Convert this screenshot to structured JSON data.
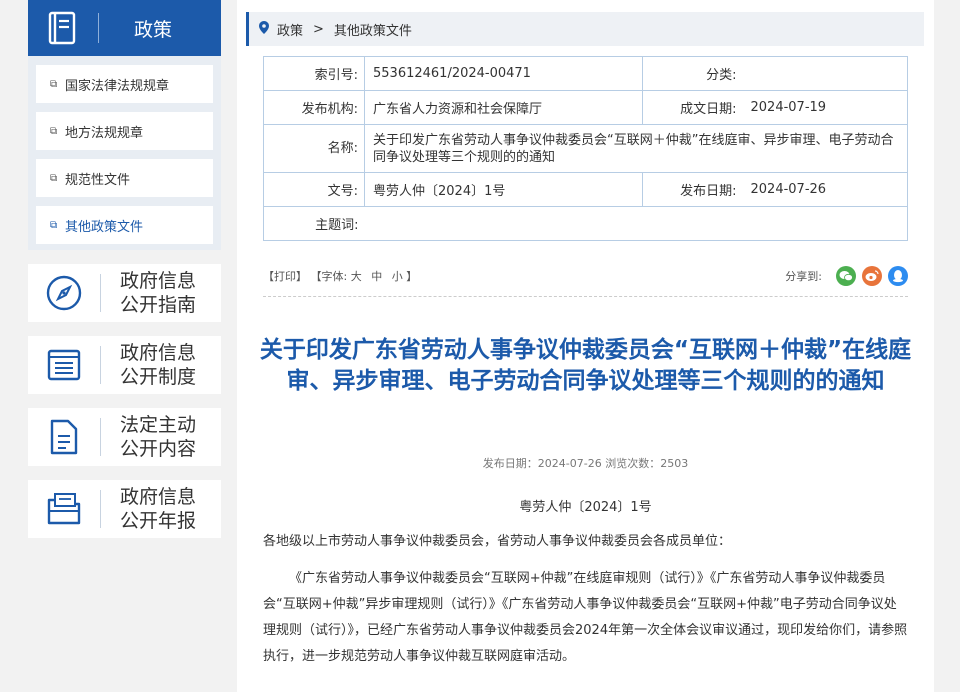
{
  "sidebar": {
    "policy_title": "政策",
    "sub_items": [
      {
        "label": "国家法律法规规章",
        "active": false
      },
      {
        "label": "地方法规规章",
        "active": false
      },
      {
        "label": "规范性文件",
        "active": false
      },
      {
        "label": "其他政策文件",
        "active": true
      }
    ],
    "big_items": [
      {
        "line1": "政府信息",
        "line2": "公开指南",
        "icon": "compass-icon"
      },
      {
        "line1": "政府信息",
        "line2": "公开制度",
        "icon": "list-icon"
      },
      {
        "line1": "法定主动",
        "line2": "公开内容",
        "icon": "document-icon"
      },
      {
        "line1": "政府信息",
        "line2": "公开年报",
        "icon": "folder-icon"
      }
    ]
  },
  "breadcrumb": {
    "items": [
      "政策",
      "其他政策文件"
    ],
    "separator": ">"
  },
  "meta": {
    "index_label": "索引号:",
    "index_value": "553612461/2024-00471",
    "category_label": "分类:",
    "category_value": "",
    "publisher_label": "发布机构:",
    "publisher_value": "广东省人力资源和社会保障厅",
    "created_label": "成文日期:",
    "created_value": "2024-07-19",
    "name_label": "名称:",
    "name_value": "关于印发广东省劳动人事争议仲裁委员会“互联网＋仲裁”在线庭审、异步审理、电子劳动合同争议处理等三个规则的的通知",
    "docno_label": "文号:",
    "docno_value": "粤劳人仲〔2024〕1号",
    "published_label": "发布日期:",
    "published_value": "2024-07-26",
    "keywords_label": "主题词:",
    "keywords_value": ""
  },
  "tools": {
    "print": "【打印】",
    "font_prefix": "【字体:",
    "font_large": "大",
    "font_medium": "中",
    "font_small": "小",
    "font_suffix": "】",
    "share_label": "分享到:"
  },
  "document": {
    "title": "关于印发广东省劳动人事争议仲裁委员会“互联网＋仲裁”在线庭审、异步审理、电子劳动合同争议处理等三个规则的的通知",
    "info": "发布日期：2024-07-26  浏览次数：2503",
    "doc_number": "粤劳人仲〔2024〕1号",
    "salutation": "各地级以上市劳动人事争议仲裁委员会，省劳动人事争议仲裁委员会各成员单位：",
    "body": "《广东省劳动人事争议仲裁委员会“互联网+仲裁”在线庭审规则（试行）》《广东省劳动人事争议仲裁委员会“互联网+仲裁”异步审理规则（试行）》《广东省劳动人事争议仲裁委员会“互联网+仲裁”电子劳动合同争议处理规则（试行）》，已经广东省劳动人事争议仲裁委员会2024年第一次全体会议审议通过，现印发给你们，请参照执行，进一步规范劳动人事争议仲裁互联网庭审活动。"
  },
  "colors": {
    "brand": "#1c5aaa",
    "wechat": "#4caf50",
    "weibo": "#e8743b",
    "qq": "#2d8cf0"
  }
}
